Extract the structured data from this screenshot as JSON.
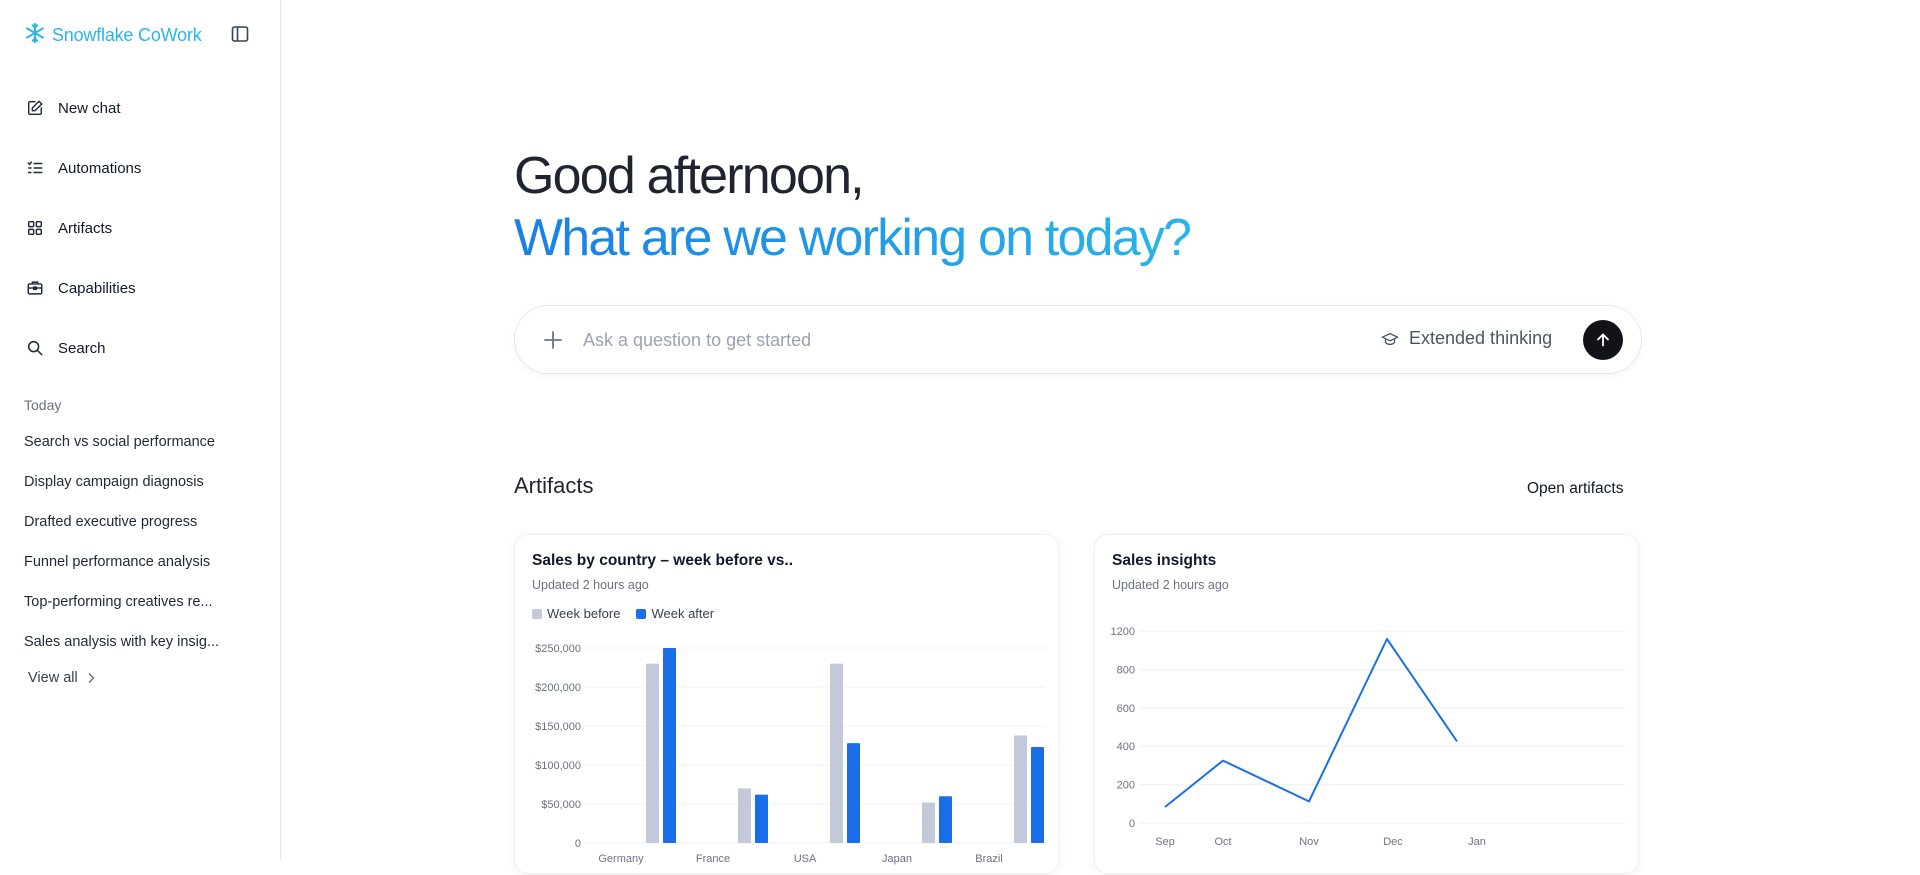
{
  "brand": {
    "name": "Snowflake CoWork"
  },
  "nav": [
    {
      "label": "New chat",
      "icon": "edit-icon"
    },
    {
      "label": "Automations",
      "icon": "checklist-icon"
    },
    {
      "label": "Artifacts",
      "icon": "grid-icon"
    },
    {
      "label": "Capabilities",
      "icon": "toolbox-icon"
    },
    {
      "label": "Search",
      "icon": "search-icon"
    }
  ],
  "history": {
    "section_label": "Today",
    "items": [
      "Search vs social performance",
      "Display campaign diagnosis",
      "Drafted executive progress",
      "Funnel performance analysis",
      "Top-performing creatives re...",
      "Sales analysis with key insig..."
    ],
    "view_all": "View all"
  },
  "greeting": {
    "line1": "Good afternoon,",
    "line2": "What are we working on today?"
  },
  "ask": {
    "placeholder": "Ask a question to get started",
    "extended_thinking": "Extended thinking"
  },
  "artifacts": {
    "title": "Artifacts",
    "open_label": "Open artifacts"
  },
  "colors": {
    "brand": "#29b5e8",
    "accent_blue": "#1a6ee8",
    "week_before": "#c3c9d9"
  },
  "chart_data": [
    {
      "type": "bar",
      "title": "Sales by country – week before vs..",
      "subtitle": "Updated 2 hours ago",
      "categories": [
        "Germany",
        "France",
        "USA",
        "Japan",
        "Brazil"
      ],
      "series": [
        {
          "name": "Week before",
          "values": [
            230000,
            70000,
            230000,
            52000,
            138000
          ]
        },
        {
          "name": "Week after",
          "values": [
            250000,
            62000,
            128000,
            60000,
            123000
          ]
        }
      ],
      "y_ticks": [
        "0",
        "$50,000",
        "$100,000",
        "$150,000",
        "$200,000",
        "$250,000"
      ],
      "ylim": [
        0,
        250000
      ],
      "legend": "top-left",
      "grid": true
    },
    {
      "type": "line",
      "title": "Sales insights",
      "subtitle": "Updated 2 hours ago",
      "x_ticks": [
        "Sep",
        "Oct",
        "Nov",
        "Dec",
        "Jan"
      ],
      "series": [
        {
          "values": [
            100,
            390,
            135,
            1150,
            510
          ]
        }
      ],
      "y_ticks": [
        "0",
        "200",
        "400",
        "600",
        "800",
        "1200"
      ],
      "ylim": [
        0,
        1200
      ],
      "grid": true
    }
  ]
}
